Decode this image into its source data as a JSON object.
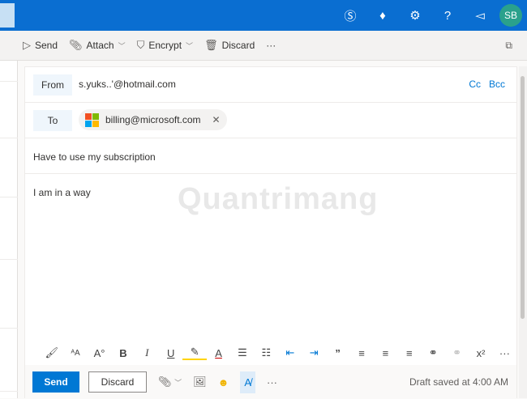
{
  "header": {
    "icons": [
      "skype-icon",
      "diamond-icon",
      "gear-icon",
      "help-icon",
      "megaphone-icon"
    ],
    "avatar_initials": "SB",
    "brand_color": "#0a6ed1"
  },
  "toolbar": {
    "send": "Send",
    "attach": "Attach",
    "encrypt": "Encrypt",
    "discard": "Discard",
    "more": "···"
  },
  "compose": {
    "from_label": "From",
    "from_value": "s.yuks..'@hotmail.com",
    "cc": "Cc",
    "bcc": "Bcc",
    "to_label": "To",
    "to_recipient": "billing@microsoft.com",
    "remove": "✕",
    "subject": "Have to use my subscription",
    "body": "I am in a way",
    "watermark": "Quantrimang"
  },
  "format_bar": [
    "format-painter",
    "font-size",
    "grow-font",
    "bold",
    "italic",
    "underline",
    "highlight",
    "font-color",
    "bullets",
    "numbering",
    "decrease-indent",
    "increase-indent",
    "quote",
    "align-left",
    "align-center",
    "align-right",
    "link",
    "unlink",
    "superscript",
    "more"
  ],
  "actions": {
    "send": "Send",
    "discard": "Discard",
    "more": "···",
    "draft_status": "Draft saved at 4:00 AM"
  }
}
